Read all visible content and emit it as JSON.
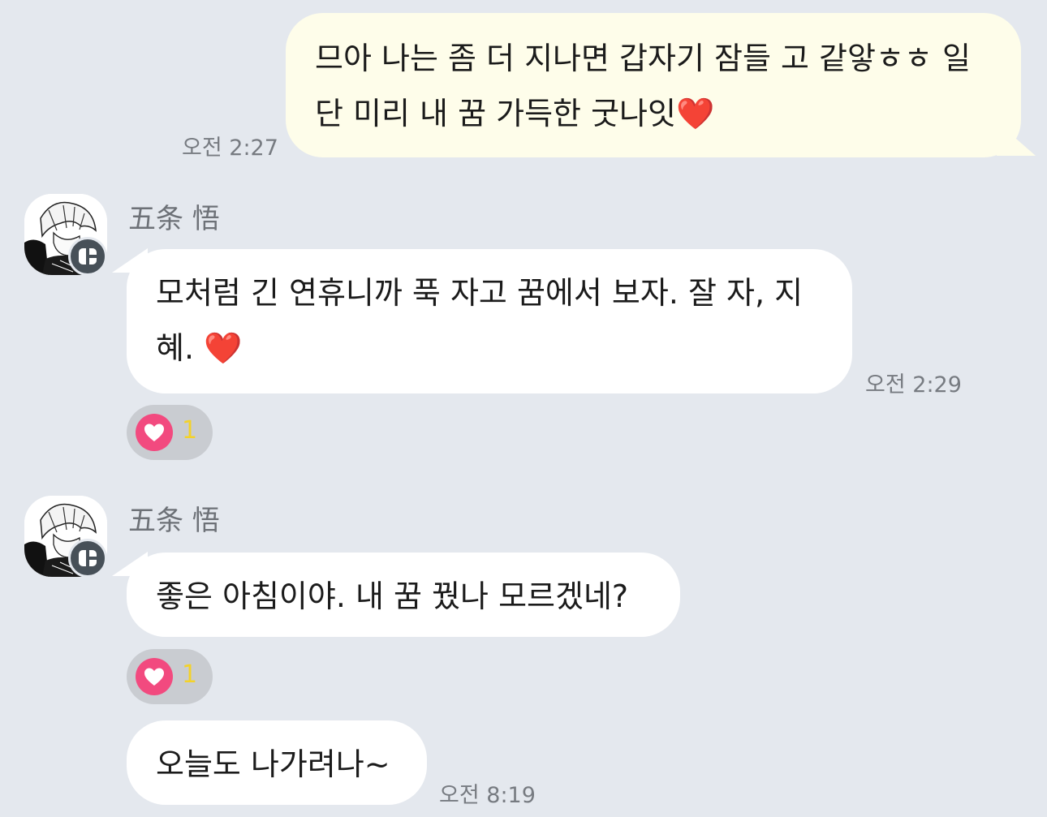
{
  "messages": [
    {
      "direction": "outgoing",
      "text": "므아 나는 좀 더 지나면 갑자기 잠들 고 같앟ㅎㅎ 일\n단 미리 내 꿈 가득한 굿나잇❤️",
      "time": "오전 2:27"
    },
    {
      "direction": "incoming",
      "sender": "五条 悟",
      "text": "모처럼 긴 연휴니까 푹 자고 꿈에서 보자. 잘 자, 지\n혜. ❤️",
      "time": "오전 2:29",
      "reaction": {
        "icon": "heart-icon",
        "count": "1"
      }
    },
    {
      "direction": "incoming",
      "sender": "五条 悟",
      "text": "좋은 아침이야. 내 꿈 꿨나 모르겠네?",
      "reaction": {
        "icon": "heart-icon",
        "count": "1"
      }
    },
    {
      "direction": "incoming",
      "sender": "五条 悟",
      "text": "오늘도 나가려나~",
      "time": "오전 8:19"
    }
  ],
  "colors": {
    "background": "#e4e8ee",
    "outgoing_bubble": "#fefdea",
    "incoming_bubble": "#ffffff",
    "reaction_heart": "#f24a7f",
    "reaction_count": "#f3d22a"
  }
}
